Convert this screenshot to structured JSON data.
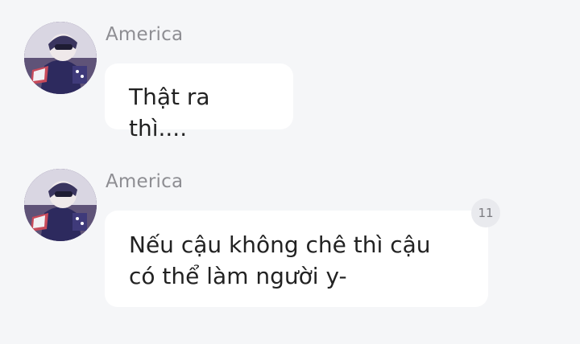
{
  "messages": [
    {
      "sender": "America",
      "text": "Thật ra thì...."
    },
    {
      "sender": "America",
      "line1": "Nếu cậu không chê thì cậu",
      "line2": "có thể làm người y-",
      "comment_count": "11"
    }
  ],
  "colors": {
    "background": "#f5f6f8",
    "bubble": "#ffffff",
    "sender": "#8e8e93",
    "badge": "#e9eaee"
  }
}
